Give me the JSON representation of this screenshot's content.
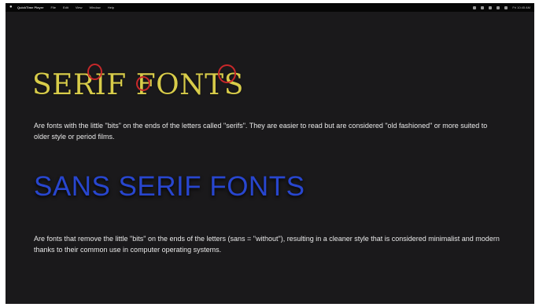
{
  "menubar": {
    "app_name": "QuickTime Player",
    "menu_items": [
      "File",
      "Edit",
      "View",
      "Window",
      "Help"
    ],
    "clock": "Fri 10:45 AM"
  },
  "slide": {
    "serif_heading": "SERIF FONTS",
    "serif_description": "Are fonts with the little \"bits\" on the ends of the letters called \"serifs\". They are easier to read but are considered \"old fashioned\" or more suited to older style or period films.",
    "sans_heading": "SANS SERIF FONTS",
    "sans_description": "Are fonts that remove the little \"bits\" on the ends of the letters (sans = \"without\"), resulting in a cleaner style that is considered minimalist and modern thanks to their common use in computer operating systems."
  },
  "colors": {
    "background": "#1a191b",
    "serif_heading": "#d8cc4a",
    "sans_heading": "#2846ce",
    "annotation_circle": "#c8282a"
  }
}
